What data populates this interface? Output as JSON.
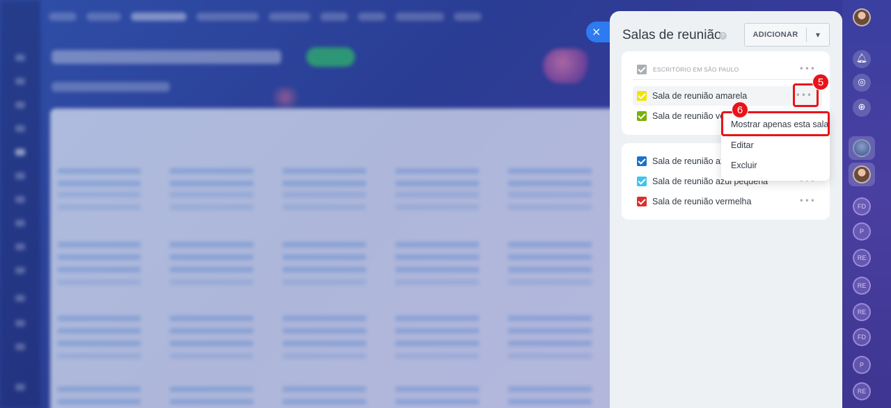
{
  "panel": {
    "title": "Salas de reunião",
    "add_button": "ADICIONAR",
    "close_icon": "×"
  },
  "groups": [
    {
      "section_label": "ESCRITÓRIO EM SÃO PAULO",
      "rooms": [
        {
          "label": "Sala de reunião amarela",
          "color": "#f2e400"
        },
        {
          "label": "Sala de reunião ver",
          "color": "#78b000"
        }
      ]
    },
    {
      "rooms": [
        {
          "label": "Sala de reunião azu",
          "color": "#1a73c9"
        },
        {
          "label": "Sala de reunião azul pequena",
          "color": "#3fc4ee"
        },
        {
          "label": "Sala de reunião vermelha",
          "color": "#e12c2c"
        }
      ]
    }
  ],
  "context_menu": {
    "items": [
      "Mostrar apenas esta sala",
      "Editar",
      "Excluir"
    ]
  },
  "annotations": {
    "step5": "5",
    "step6": "6"
  },
  "rail": {
    "initials": [
      "FD",
      "P",
      "RE",
      "RE",
      "RE",
      "FD",
      "P",
      "RE"
    ]
  },
  "colors": {
    "accent_blue": "#2e7af0",
    "annotation_red": "#e8141a",
    "section_check": "#9aa0a8"
  }
}
